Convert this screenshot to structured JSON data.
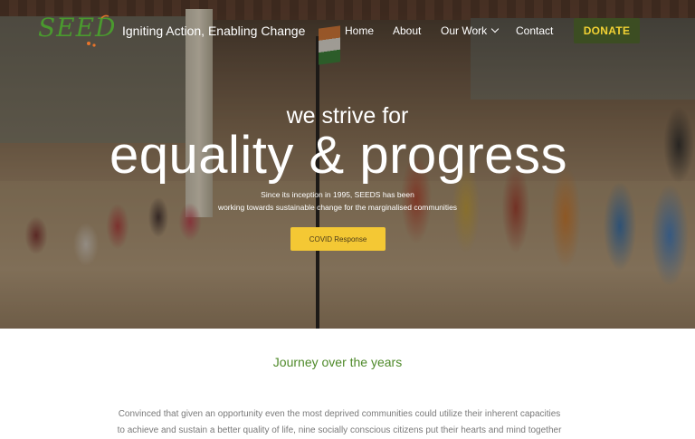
{
  "header": {
    "logo_text": "SEEDS",
    "tagline": "Igniting Action, Enabling Change",
    "nav": [
      {
        "label": "Home"
      },
      {
        "label": "About"
      },
      {
        "label": "Our Work"
      },
      {
        "label": "Contact"
      }
    ],
    "donate_label": "DONATE"
  },
  "hero": {
    "subtitle": "we strive for",
    "title": "equality & progress",
    "description_line1": "Since its inception in 1995, SEEDS has been",
    "description_line2": "working towards sustainable change for the marginalised communities",
    "cta_label": "COVID Response"
  },
  "journey": {
    "heading": "Journey over the years",
    "paragraph_line1": "Convinced that given an opportunity even the most deprived communities could utilize their inherent capacities",
    "paragraph_line2": "to achieve and sustain a better quality of life, nine socially conscious citizens put their hearts and mind together"
  },
  "colors": {
    "logo_green": "#4a9a2e",
    "logo_orange": "#e8742a",
    "donate_bg": "#3c4d22",
    "donate_text": "#f3d233",
    "cta_bg": "#f4c834",
    "heading_green": "#4f8a2a"
  },
  "icons": {
    "our_work_dropdown": "chevron-down-icon"
  }
}
